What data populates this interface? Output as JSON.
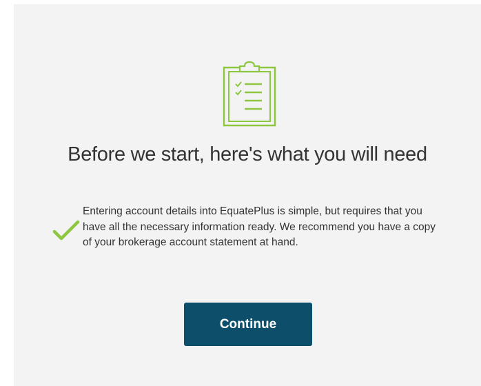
{
  "dialog": {
    "heading": "Before we start, here's what you will need",
    "note": "Entering account details into EquatePlus is simple, but requires that you have all the necessary information ready. We recommend you have a copy of your brokerage account statement at hand.",
    "continue_label": "Continue"
  },
  "icons": {
    "header": "clipboard-checklist-icon",
    "note": "checkmark-icon"
  },
  "colors": {
    "accent_green": "#8dc63f",
    "button_bg": "#0d4f6b",
    "panel_bg": "#f3f3f4",
    "text": "#333333"
  }
}
